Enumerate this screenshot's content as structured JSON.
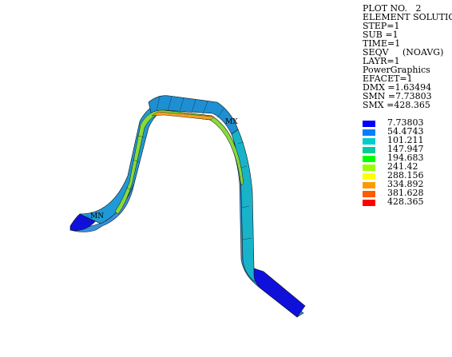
{
  "info_lines": [
    "PLOT NO.   2",
    "ELEMENT SOLUTION",
    "STEP=1",
    "SUB =1",
    "TIME=1",
    "SEQV     (NOAVG)",
    "LAYR=1",
    "PowerGraphics",
    "EFACET=1",
    "DMX =1.63494",
    "SMN =7.73803",
    "SMX =428.365"
  ],
  "legend": {
    "values": [
      "7.73803",
      "54.4743",
      "101.211",
      "147.947",
      "194.683",
      "241.42",
      "288.156",
      "334.892",
      "381.628",
      "428.365"
    ],
    "colors": [
      "#0000ff",
      "#007fff",
      "#00cccc",
      "#00cc99",
      "#00ff00",
      "#99ff00",
      "#ffff00",
      "#ff9900",
      "#ff5a00",
      "#ff0000"
    ]
  },
  "markers": {
    "min_label": "MN",
    "max_label": "MX"
  }
}
